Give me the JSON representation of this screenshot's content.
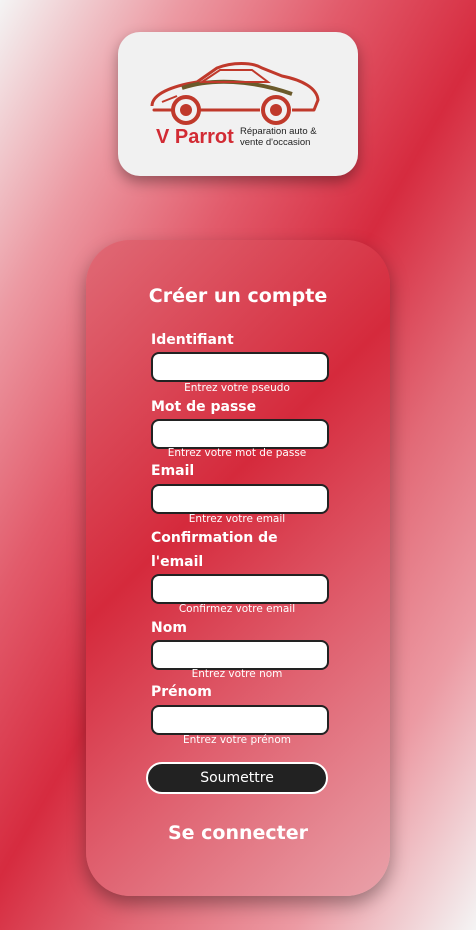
{
  "logo": {
    "brand": "V Parrot",
    "tagline": "Réparation auto & vente d'occasion",
    "icon": "car-icon"
  },
  "form": {
    "title": "Créer un compte",
    "fields": [
      {
        "label": "Identifiant",
        "hint": "Entrez votre pseudo",
        "value": "",
        "placeholder": ""
      },
      {
        "label": "Mot de passe",
        "hint": "Entrez votre mot de passe",
        "value": "",
        "placeholder": ""
      },
      {
        "label": "Email",
        "hint": "Entrez votre email",
        "value": "",
        "placeholder": ""
      },
      {
        "label": "Confirmation de l'email",
        "hint": "Confirmez votre email",
        "value": "",
        "placeholder": ""
      },
      {
        "label": "Nom",
        "hint": "Entrez votre nom",
        "value": "",
        "placeholder": ""
      },
      {
        "label": "Prénom",
        "hint": "Entrez votre prénom",
        "value": "",
        "placeholder": ""
      }
    ],
    "submit_label": "Soumettre",
    "login_link": "Se connecter"
  },
  "colors": {
    "accent": "#d62b3f",
    "brand_red": "#d22b34",
    "button_bg": "#222222"
  }
}
